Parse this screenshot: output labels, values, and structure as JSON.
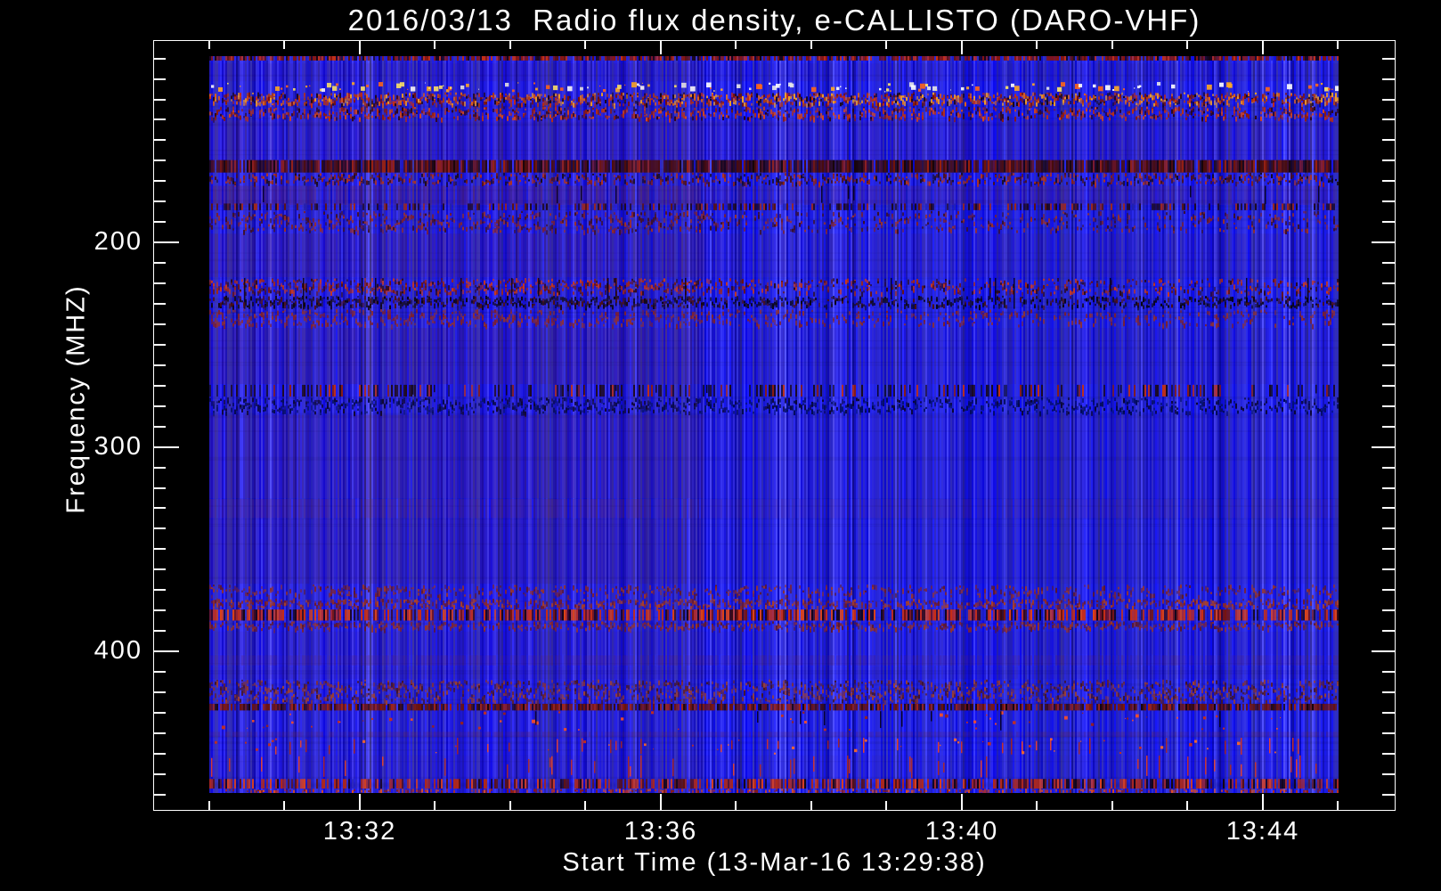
{
  "window": {
    "background": "#000000",
    "text_color": "#ffffff"
  },
  "chart_data": {
    "type": "heatmap",
    "title": "2016/03/13  Radio flux density, e-CALLISTO (DARO-VHF)",
    "xlabel": "Start Time (13-Mar-16 13:29:38)",
    "ylabel": "Frequency (MHZ)",
    "x_axis": {
      "label": "Start Time (13-Mar-16 13:29:38)",
      "major_ticks": [
        {
          "label": "13:32",
          "frac": 0.1663
        },
        {
          "label": "13:36",
          "frac": 0.4086
        },
        {
          "label": "13:40",
          "frac": 0.6509
        },
        {
          "label": "13:44",
          "frac": 0.8932
        }
      ],
      "minor_first_frac": 0.04516,
      "minor_step_frac": 0.06057,
      "minor_count": 16,
      "minor_interval": "1 minute"
    },
    "y_axis": {
      "label": "Frequency (MHZ)",
      "inverted": true,
      "major_ticks": [
        {
          "label": "200",
          "frac": 0.26243
        },
        {
          "label": "300",
          "frac": 0.52775
        },
        {
          "label": "400",
          "frac": 0.79306
        }
      ],
      "minor_first_frac": 0.02382,
      "minor_step_frac": 0.02653,
      "minor_count": 37,
      "minor_interval": "10 MHz"
    },
    "image_region": {
      "left_frac": 0.04516,
      "top_frac": 0.0208,
      "right_frac": 0.9542,
      "bottom_frac": 0.9769
    },
    "file_boundary_frac": 0.438,
    "colors": {
      "background_blue": "#1616dc",
      "bright_blue": "#3838ff",
      "hot_red": "#cc2a10",
      "orange": "#e06418",
      "yellow": "#ffe866",
      "white_speck": "#ffffff",
      "dark_band": "#180406",
      "left_tint": "#a02850"
    },
    "bands": [
      {
        "from": 0.0,
        "to": 0.006,
        "style": "dashrow",
        "density": 0.85,
        "colors": [
          "#8a1408",
          "#c83010",
          "#140414",
          "#2a2ac8",
          "#601008"
        ]
      },
      {
        "from": 0.01,
        "to": 0.034,
        "style": "tint",
        "density": 0.1,
        "colors": [
          "#500a28"
        ]
      },
      {
        "from": 0.035,
        "to": 0.049,
        "style": "speckle",
        "density": 0.22,
        "size": 5,
        "colors": [
          "#ffffff",
          "#ffe866",
          "#ffaa22",
          "#ff6618",
          "#e8e8e8"
        ]
      },
      {
        "from": 0.049,
        "to": 0.068,
        "style": "mottle",
        "density": 0.6,
        "colors": [
          "#c82a10",
          "#e06418",
          "#f0a028",
          "#7a1008",
          "#180618",
          "#a83818"
        ]
      },
      {
        "from": 0.068,
        "to": 0.087,
        "style": "mottle",
        "density": 0.38,
        "colors": [
          "#b63018",
          "#8a1a10",
          "#2a0618",
          "#d84818"
        ]
      },
      {
        "from": 0.087,
        "to": 0.14,
        "style": "tint",
        "density": 0.14,
        "colors": [
          "#6a1438"
        ]
      },
      {
        "from": 0.141,
        "to": 0.158,
        "style": "dashrow",
        "density": 0.92,
        "colors": [
          "#4a0c06",
          "#180406",
          "#701408",
          "#9a2008",
          "#2a0a18"
        ]
      },
      {
        "from": 0.158,
        "to": 0.175,
        "style": "mottle",
        "density": 0.42,
        "colors": [
          "#8a2014",
          "#48101c",
          "#b03420",
          "#140a20"
        ]
      },
      {
        "from": 0.176,
        "to": 0.202,
        "style": "tint",
        "density": 0.22,
        "left_extra": 0.08,
        "colors": [
          "#70203c"
        ]
      },
      {
        "from": 0.176,
        "to": 0.202,
        "style": "vtick",
        "density": 0.03,
        "colors": [
          "#050010"
        ]
      },
      {
        "from": 0.2,
        "to": 0.209,
        "style": "dashrow",
        "density": 0.45,
        "colors": [
          "#1c0820",
          "#5a1410",
          "#a02818",
          "#2020b0"
        ]
      },
      {
        "from": 0.21,
        "to": 0.24,
        "style": "mottle",
        "density": 0.22,
        "left_extra": 0.12,
        "colors": [
          "#7a2030",
          "#9a3028",
          "#3a1028"
        ]
      },
      {
        "from": 0.241,
        "to": 0.3,
        "style": "tint",
        "density": 0.12,
        "left_extra": 0.08,
        "colors": [
          "#601a3a"
        ]
      },
      {
        "from": 0.301,
        "to": 0.324,
        "style": "mottle",
        "density": 0.3,
        "left_extra": 0.2,
        "colors": [
          "#a02818",
          "#6a1410",
          "#c83820",
          "#2a0a1c"
        ]
      },
      {
        "from": 0.301,
        "to": 0.345,
        "style": "vtick",
        "density": 0.05,
        "colors": [
          "#050010"
        ]
      },
      {
        "from": 0.325,
        "to": 0.342,
        "style": "mottle",
        "density": 0.45,
        "left_extra": 0.15,
        "colors": [
          "#0a0618",
          "#161030",
          "#4a1014",
          "#080410"
        ]
      },
      {
        "from": 0.343,
        "to": 0.368,
        "style": "mottle",
        "density": 0.18,
        "left_extra": 0.15,
        "colors": [
          "#7a2030",
          "#8a3038"
        ]
      },
      {
        "from": 0.369,
        "to": 0.445,
        "style": "tint",
        "density": 0.1,
        "left_extra": 0.1,
        "colors": [
          "#5a1a3a"
        ]
      },
      {
        "from": 0.446,
        "to": 0.462,
        "style": "dashrow",
        "density": 0.3,
        "colors": [
          "#1a0a1c",
          "#8a1c10",
          "#c03018",
          "#101040"
        ]
      },
      {
        "from": 0.446,
        "to": 0.462,
        "style": "vtick",
        "density": 0.04,
        "colors": [
          "#050010"
        ]
      },
      {
        "from": 0.463,
        "to": 0.486,
        "style": "mottle",
        "density": 0.35,
        "left_extra": 0.1,
        "colors": [
          "#000a50",
          "#041272",
          "#0a0630"
        ]
      },
      {
        "from": 0.487,
        "to": 0.6,
        "style": "tint",
        "density": 0.09,
        "left_extra": 0.11,
        "colors": [
          "#58183a"
        ]
      },
      {
        "from": 0.601,
        "to": 0.627,
        "style": "tint",
        "density": 0.17,
        "left_extra": 0.08,
        "colors": [
          "#68203c"
        ]
      },
      {
        "from": 0.628,
        "to": 0.716,
        "style": "tint",
        "density": 0.07,
        "left_extra": 0.1,
        "colors": [
          "#521638"
        ]
      },
      {
        "from": 0.717,
        "to": 0.735,
        "style": "mottle",
        "density": 0.3,
        "colors": [
          "#78243a",
          "#5a1830",
          "#94342e"
        ]
      },
      {
        "from": 0.736,
        "to": 0.75,
        "style": "mottle",
        "density": 0.42,
        "colors": [
          "#8a2a2a",
          "#6a1a2e",
          "#a8402a"
        ]
      },
      {
        "from": 0.751,
        "to": 0.766,
        "style": "dashrow",
        "density": 0.78,
        "colors": [
          "#cc2e10",
          "#e04414",
          "#120414",
          "#2424bc",
          "#7a1408",
          "#3a0a10"
        ]
      },
      {
        "from": 0.767,
        "to": 0.78,
        "style": "mottle",
        "density": 0.35,
        "colors": [
          "#7a2438",
          "#5c1830",
          "#96362c"
        ]
      },
      {
        "from": 0.781,
        "to": 0.812,
        "style": "tint",
        "density": 0.08,
        "colors": [
          "#521638"
        ]
      },
      {
        "from": 0.813,
        "to": 0.827,
        "style": "tint",
        "density": 0.2,
        "colors": [
          "#662040"
        ]
      },
      {
        "from": 0.828,
        "to": 0.845,
        "style": "tint",
        "density": 0.09,
        "colors": [
          "#521638"
        ]
      },
      {
        "from": 0.846,
        "to": 0.878,
        "style": "mottle",
        "density": 0.4,
        "colors": [
          "#7c3042",
          "#5a2034",
          "#9a4034",
          "#401426"
        ]
      },
      {
        "from": 0.879,
        "to": 0.888,
        "style": "dashrow",
        "density": 0.8,
        "colors": [
          "#6a1208",
          "#3a0a08",
          "#a02410",
          "#180408",
          "#801808"
        ]
      },
      {
        "from": 0.889,
        "to": 0.916,
        "style": "speckle",
        "density": 0.1,
        "size": 3,
        "colors": [
          "#d03010",
          "#ff5020",
          "#a02010"
        ]
      },
      {
        "from": 0.889,
        "to": 0.916,
        "style": "vtick",
        "density": 0.03,
        "colors": [
          "#050010"
        ]
      },
      {
        "from": 0.917,
        "to": 0.924,
        "style": "tint",
        "density": 0.24,
        "colors": [
          "#6c2240"
        ]
      },
      {
        "from": 0.925,
        "to": 0.948,
        "style": "vstreak",
        "density": 0.05,
        "colors": [
          "#e03414",
          "#ff4818",
          "#b02410"
        ]
      },
      {
        "from": 0.925,
        "to": 0.948,
        "style": "speckle",
        "density": 0.06,
        "size": 3,
        "colors": [
          "#d03010",
          "#ff6a22"
        ]
      },
      {
        "from": 0.949,
        "to": 0.98,
        "style": "vstreak",
        "density": 0.07,
        "colors": [
          "#e03414",
          "#ff4818",
          "#c02c12"
        ]
      },
      {
        "from": 0.949,
        "to": 0.98,
        "style": "tint",
        "density": 0.06,
        "colors": [
          "#581a38"
        ]
      },
      {
        "from": 0.981,
        "to": 0.994,
        "style": "dashrow",
        "density": 0.72,
        "colors": [
          "#b02818",
          "#5a1010",
          "#140410",
          "#d84020",
          "#2828c0"
        ]
      },
      {
        "from": 0.994,
        "to": 1.0,
        "style": "mottle",
        "density": 0.45,
        "colors": [
          "#c03018",
          "#8a1c10",
          "#e05020"
        ]
      }
    ]
  }
}
